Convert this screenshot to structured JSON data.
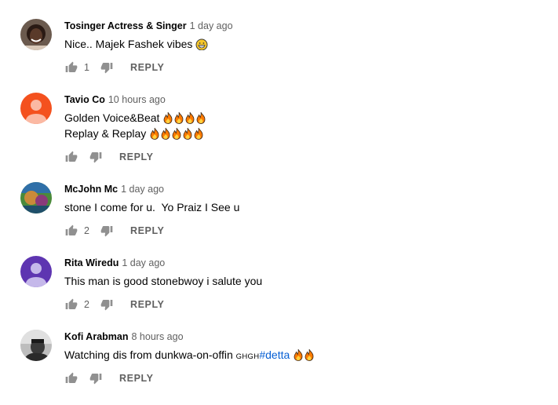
{
  "reply_label": "REPLY",
  "comments": [
    {
      "author": "Tosinger Actress & Singer",
      "time": "1 day ago",
      "lines": [
        {
          "text": "Nice.. Majek Fashek vibes",
          "suffix_emoji": "grinning-face"
        }
      ],
      "likes": "1",
      "avatar": "photo-woman"
    },
    {
      "author": "Tavio Co",
      "time": "10 hours ago",
      "lines": [
        {
          "text": "Golden Voice&Beat",
          "fire_count": 4
        },
        {
          "text": "Replay & Replay",
          "fire_count": 5
        }
      ],
      "likes": "",
      "avatar": "default-orange"
    },
    {
      "author": "McJohn Mc",
      "time": "1 day ago",
      "lines": [
        {
          "text": "stone I come for u.  Yo Praiz I See u"
        }
      ],
      "likes": "2",
      "avatar": "photo-colorful"
    },
    {
      "author": "Rita Wiredu",
      "time": "1 day ago",
      "lines": [
        {
          "text": "This man is good stonebwoy i salute you"
        }
      ],
      "likes": "2",
      "avatar": "default-purple"
    },
    {
      "author": "Kofi Arabman",
      "time": "8 hours ago",
      "lines": [
        {
          "text": "Watching dis from dunkwa-on-offin ",
          "small": "GHGH",
          "hashtag": "#detta",
          "fire_count": 2
        }
      ],
      "likes": "",
      "avatar": "photo-grayscale"
    }
  ],
  "colors": {
    "text": "#030303",
    "secondary": "#606060",
    "link": "#065fd4",
    "avatar_orange": "#f4511e",
    "avatar_purple": "#5e35b1"
  }
}
